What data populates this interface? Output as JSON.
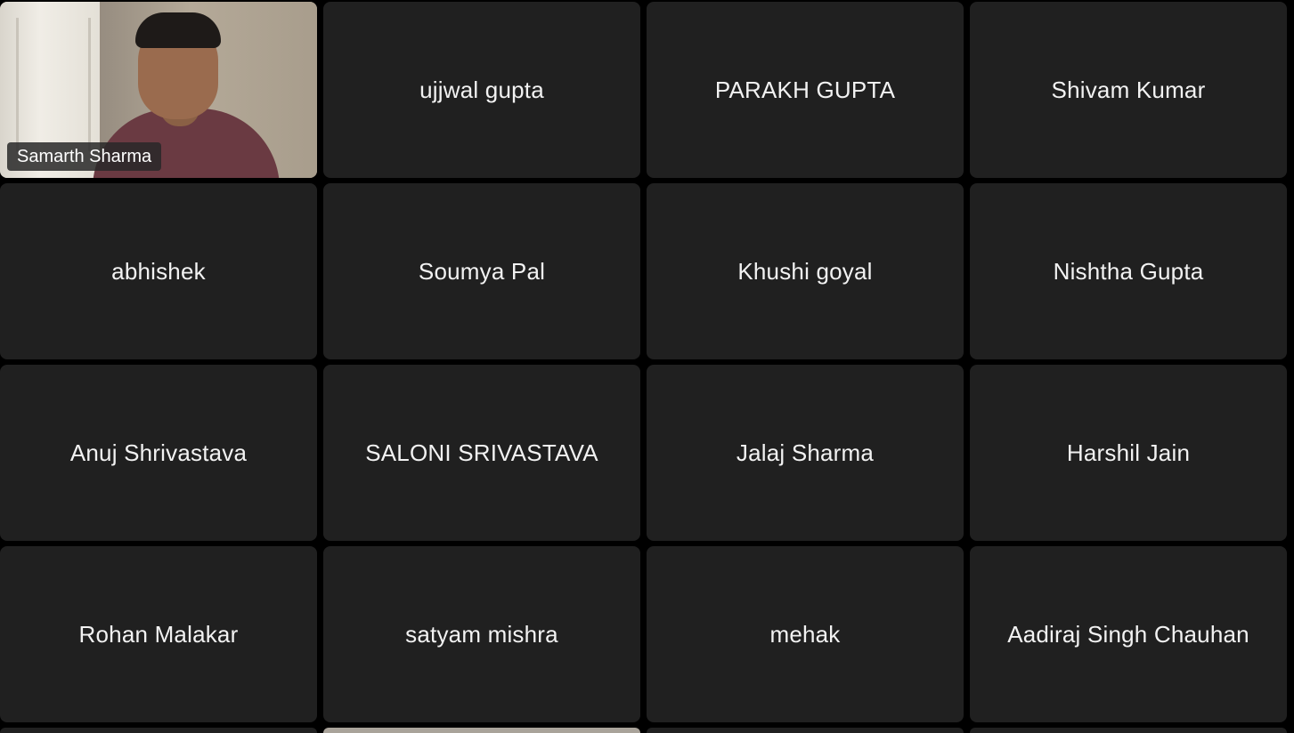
{
  "participants": [
    {
      "name": "Samarth Sharma",
      "video": true
    },
    {
      "name": "ujjwal gupta"
    },
    {
      "name": "PARAKH GUPTA"
    },
    {
      "name": "Shivam Kumar"
    },
    {
      "name": "abhishek"
    },
    {
      "name": "Soumya Pal"
    },
    {
      "name": "Khushi goyal"
    },
    {
      "name": "Nishtha Gupta"
    },
    {
      "name": "Anuj Shrivastava"
    },
    {
      "name": "SALONI SRIVASTAVA"
    },
    {
      "name": "Jalaj Sharma"
    },
    {
      "name": "Harshil Jain"
    },
    {
      "name": "Rohan Malakar"
    },
    {
      "name": "satyam mishra"
    },
    {
      "name": "mehak"
    },
    {
      "name": "Aadiraj Singh Chauhan"
    }
  ],
  "colors": {
    "background": "#000000",
    "tile": "#202020",
    "text": "#f2f2f2"
  }
}
